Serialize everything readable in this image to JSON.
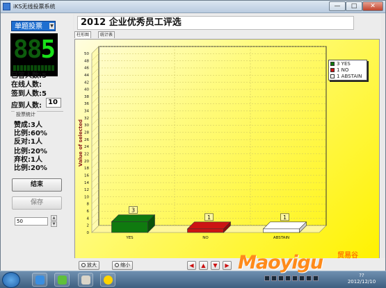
{
  "window": {
    "title": "iKS无线投票系统",
    "min": "—",
    "max": "□",
    "close": "✕"
  },
  "left": {
    "mode": "单题投票",
    "led_digits": [
      "8",
      "8",
      "5"
    ],
    "stats": {
      "answered": "已答人数:5",
      "online": "在线人数:",
      "signed": "签到人数:5",
      "expected_label": "应到人数:",
      "expected_value": "10"
    },
    "vote_stats": {
      "legend": "投票统计",
      "lines": [
        "赞成:3人",
        "比例:60%",
        "反对:1人",
        "比例:20%",
        "弃权:1人",
        "比例:20%"
      ]
    },
    "end_button": "结束",
    "save_button": "保存",
    "spin_value": "50",
    "spin_up": "▲",
    "spin_down": "▼"
  },
  "main": {
    "title": "2012 企业优秀员工评选",
    "tabs": [
      "柱形图",
      "统计表"
    ]
  },
  "bottom": {
    "zoom_in": "放大",
    "zoom_out": "缩小",
    "arrows": [
      "◀",
      "▲",
      "▼",
      "▶"
    ]
  },
  "chart_data": {
    "type": "bar",
    "categories": [
      "YES",
      "NO",
      "ABSTAIN"
    ],
    "values": [
      3,
      1,
      1
    ],
    "colors": [
      "#0f7a0f",
      "#cc1414",
      "#ffffff"
    ],
    "data_labels": [
      "3",
      "1",
      "1"
    ],
    "ylabel": "Value of selected",
    "ylim": [
      0,
      50
    ],
    "ytick_step": 2,
    "grid": true,
    "legend_position": "top-right",
    "legend": [
      "3 YES",
      "1 NO",
      "1 ABSTAIN"
    ]
  },
  "taskbar": {
    "clock": "??",
    "date": "2012/12/10"
  },
  "watermark": {
    "text": "Maoyigu",
    "cn": "贸易谷"
  }
}
